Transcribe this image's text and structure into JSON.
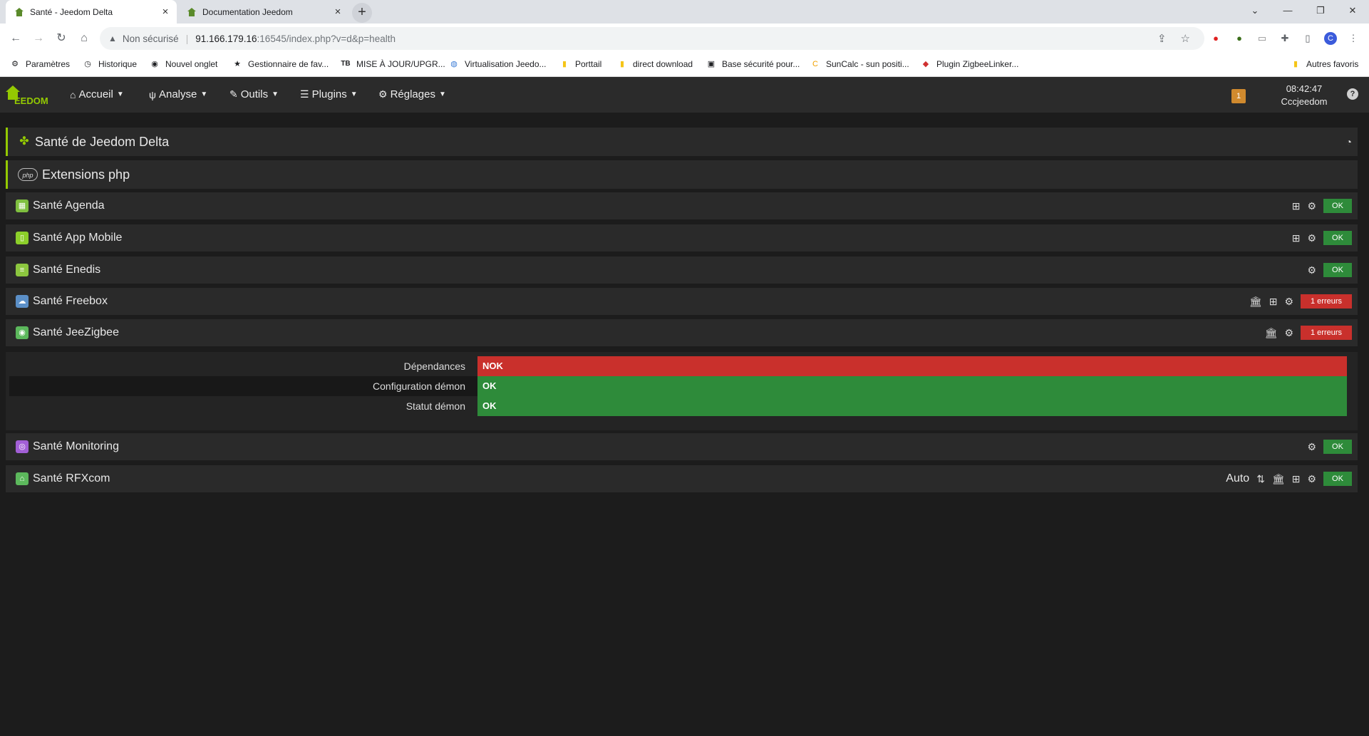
{
  "browser": {
    "tabs": [
      {
        "title": "Santé - Jeedom Delta",
        "active": true
      },
      {
        "title": "Documentation Jeedom",
        "active": false
      }
    ],
    "new_tab": "+",
    "address": {
      "insecure_label": "Non sécurisé",
      "host": "91.166.179.16",
      "path": ":16545/index.php?v=d&p=health"
    },
    "bookmarks": [
      {
        "label": "Paramètres",
        "icon": "gear-icon"
      },
      {
        "label": "Historique",
        "icon": "history-icon"
      },
      {
        "label": "Nouvel onglet",
        "icon": "globe-icon"
      },
      {
        "label": "Gestionnaire de fav...",
        "icon": "star-icon"
      },
      {
        "label": "MISE À JOUR/UPGR...",
        "icon": "tb-icon"
      },
      {
        "label": "Virtualisation Jeedo...",
        "icon": "globe-icon"
      },
      {
        "label": "Porttail",
        "icon": "folder-icon"
      },
      {
        "label": "direct download",
        "icon": "folder-icon"
      },
      {
        "label": "Base sécurité pour...",
        "icon": "doc-icon"
      },
      {
        "label": "SunCalc - sun positi...",
        "icon": "sun-icon"
      },
      {
        "label": "Plugin ZigbeeLinker...",
        "icon": "plugin-icon"
      }
    ],
    "other_bookmarks": "Autres favoris",
    "profile_initial": "C"
  },
  "navbar": {
    "menus": [
      {
        "label": "Accueil"
      },
      {
        "label": "Analyse"
      },
      {
        "label": "Outils"
      },
      {
        "label": "Plugins"
      },
      {
        "label": "Réglages"
      }
    ],
    "message_count": "1",
    "time": "08:42:47",
    "user": "Cccjeedom",
    "help": "?"
  },
  "page": {
    "title": "Santé de Jeedom Delta",
    "php_section": "Extensions php",
    "panels": [
      {
        "name": "Santé Agenda",
        "status": "OK",
        "color": "#7fbf3f"
      },
      {
        "name": "Santé App Mobile",
        "status": "OK",
        "color": "#8ccf2a"
      },
      {
        "name": "Santé Enedis",
        "status": "OK",
        "color": "#8cc63f"
      },
      {
        "name": "Santé Freebox",
        "status": "1 erreurs",
        "color": "#5b8fc7"
      },
      {
        "name": "Santé JeeZigbee",
        "status": "1 erreurs",
        "color": "#5cb85c"
      },
      {
        "name": "Santé Monitoring",
        "status": "OK",
        "color": "#a25fd6"
      },
      {
        "name": "Santé RFXcom",
        "status": "OK",
        "color": "#5cb85c",
        "mode": "Auto"
      }
    ],
    "jeezigbee_details": [
      {
        "label": "Dépendances",
        "value": "NOK",
        "ok": false
      },
      {
        "label": "Configuration démon",
        "value": "OK",
        "ok": true
      },
      {
        "label": "Statut démon",
        "value": "OK",
        "ok": true
      }
    ]
  }
}
